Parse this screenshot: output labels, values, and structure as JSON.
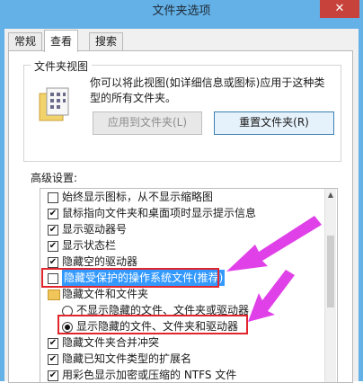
{
  "window": {
    "title": "文件夹选项",
    "close_glyph": "✕"
  },
  "tabs": [
    {
      "label": "常规"
    },
    {
      "label": "查看"
    },
    {
      "label": "搜索"
    }
  ],
  "folder_views": {
    "caption": "文件夹视图",
    "description": "你可以将此视图(如详细信息或图标)应用于这种类型的所有文件夹。",
    "apply_button": "应用到文件夹(L)",
    "reset_button": "重置文件夹(R)"
  },
  "advanced": {
    "label": "高级设置:",
    "items": [
      {
        "label": "始终显示图标，从不显示缩略图"
      },
      {
        "label": "鼠标指向文件夹和桌面项时显示提示信息"
      },
      {
        "label": "显示驱动器号"
      },
      {
        "label": "显示状态栏"
      },
      {
        "label": "隐藏空的驱动器"
      },
      {
        "label": "隐藏受保护的操作系统文件(推荐)"
      },
      {
        "label": "隐藏文件和文件夹"
      },
      {
        "label": "不显示隐藏的文件、文件夹或驱动器"
      },
      {
        "label": "显示隐藏的文件、文件夹和驱动器"
      },
      {
        "label": "隐藏文件夹合并冲突"
      },
      {
        "label": "隐藏已知文件类型的扩展名"
      },
      {
        "label": "用彩色显示加密或压缩的 NTFS 文件"
      }
    ],
    "checkmark_glyph": "✔",
    "scroll_up_glyph": "▲"
  },
  "colors": {
    "title_bar": "#64b1e7",
    "close": "#c7423a",
    "selection": "#3399ff",
    "highlight_box": "#e0252d",
    "arrow": "#e040e8"
  }
}
